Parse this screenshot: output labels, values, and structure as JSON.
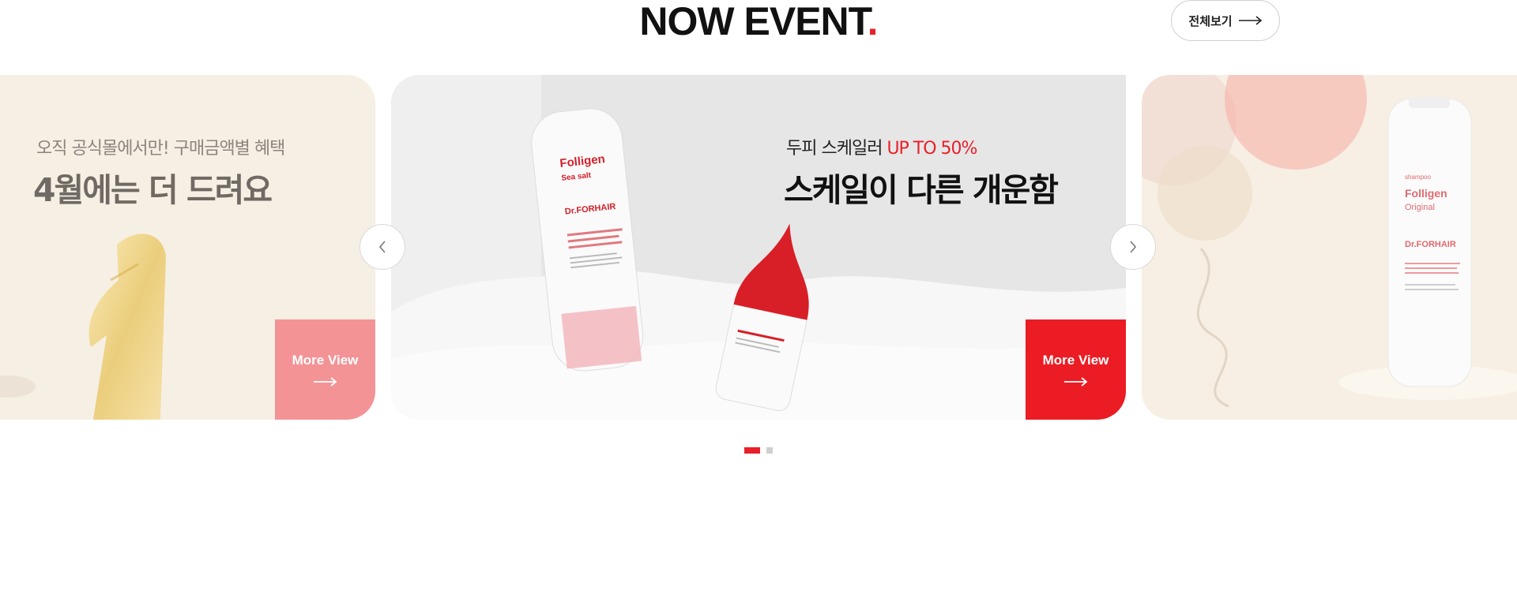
{
  "section": {
    "title": "NOW EVENT",
    "title_dot": ".",
    "view_all_label": "전체보기"
  },
  "slides": [
    {
      "subtitle": "오직 공식몰에서만! 구매금액별 혜택",
      "headline": "4월에는 더 드려요",
      "more_label": "More View"
    },
    {
      "subtitle": "두피 스케일러",
      "subtitle_accent": "UP TO 50%",
      "headline": "스케일이 다른 개운함",
      "more_label": "More View",
      "product": {
        "tube_brand": "Folligen",
        "tube_variant": "Sea salt",
        "tube_maker": "Dr.FORHAIR"
      }
    },
    {
      "product": {
        "kind": "shampoo",
        "brand": "Folligen",
        "variant": "Original",
        "maker": "Dr.FORHAIR"
      }
    }
  ],
  "pagination": {
    "total": 2,
    "active": 1
  },
  "colors": {
    "accent": "#e8202a",
    "more_red": "#ec1c24",
    "more_pink": "#f39396"
  }
}
